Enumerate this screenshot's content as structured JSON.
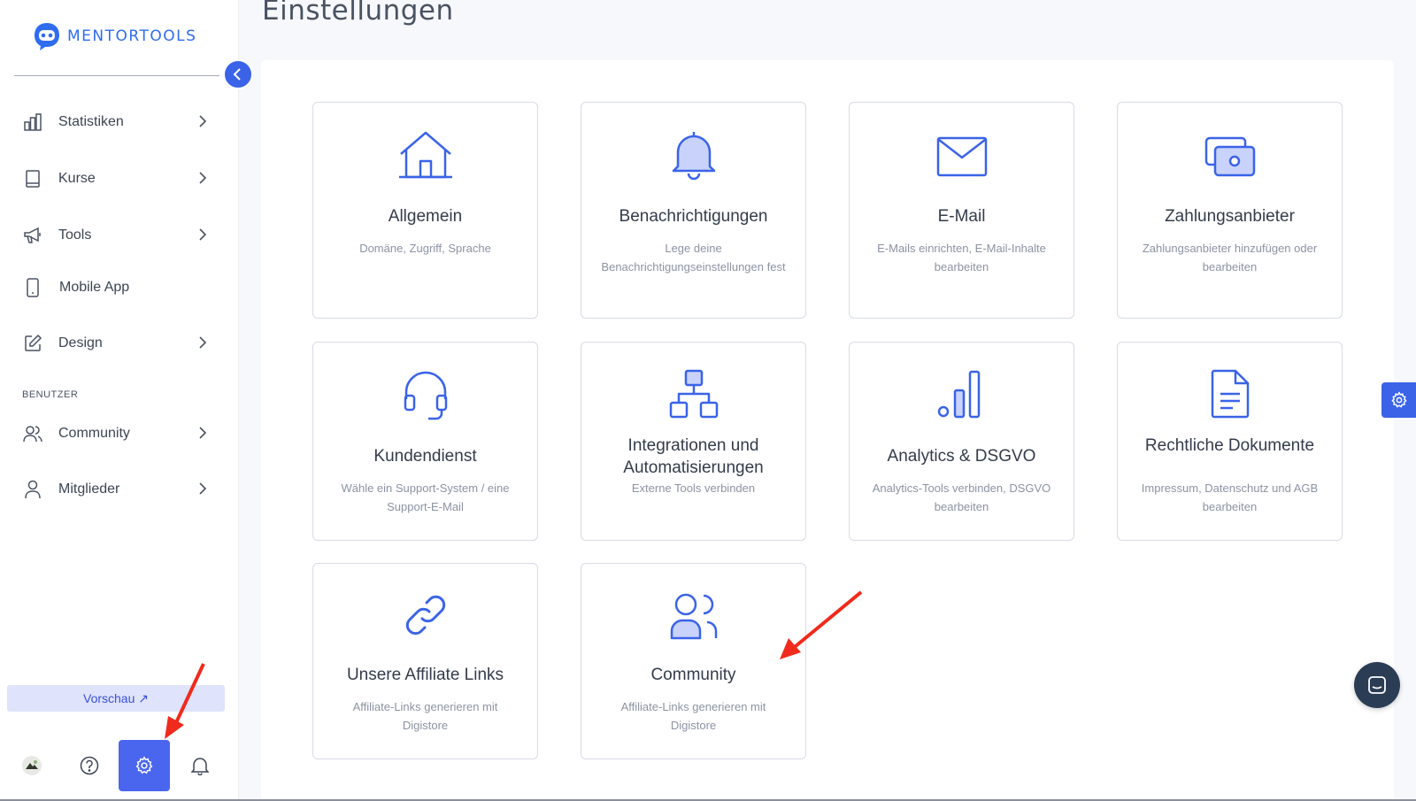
{
  "brand": {
    "name": "MENTORTOOLS",
    "color": "#2f6cf0"
  },
  "accent_color": "#3a63e8",
  "sidebar": {
    "items": [
      {
        "label": "Statistiken",
        "icon": "bar-chart-icon",
        "has_chevron": true
      },
      {
        "label": "Kurse",
        "icon": "book-icon",
        "has_chevron": true
      },
      {
        "label": "Tools",
        "icon": "megaphone-icon",
        "has_chevron": true
      },
      {
        "label": "Mobile App",
        "icon": "phone-icon",
        "has_chevron": false
      },
      {
        "label": "Design",
        "icon": "edit-icon",
        "has_chevron": true
      }
    ],
    "section_label": "BENUTZER",
    "user_items": [
      {
        "label": "Community",
        "icon": "users-icon",
        "has_chevron": true
      },
      {
        "label": "Mitglieder",
        "icon": "user-icon",
        "has_chevron": true
      }
    ],
    "preview_label": "Vorschau ↗",
    "bottom": [
      "avatar",
      "help-icon",
      "gear-icon",
      "bell-icon"
    ]
  },
  "page": {
    "title": "Einstellungen"
  },
  "cards": [
    {
      "title": "Allgemein",
      "desc": "Domäne, Zugriff, Sprache",
      "icon": "home-icon"
    },
    {
      "title": "Benachrichtigungen",
      "desc": "Lege deine Benachrichtigungseinstellungen fest",
      "icon": "bell-icon"
    },
    {
      "title": "E-Mail",
      "desc": "E-Mails einrichten, E-Mail-Inhalte bearbeiten",
      "icon": "mail-icon"
    },
    {
      "title": "Zahlungsanbieter",
      "desc": "Zahlungsanbieter hinzufügen oder bearbeiten",
      "icon": "money-icon"
    },
    {
      "title": "Kundendienst",
      "desc": "Wähle ein Support-System / eine Support-E-Mail",
      "icon": "headset-icon"
    },
    {
      "title": "Integrationen und Automatisierungen",
      "desc": "Externe Tools verbinden",
      "icon": "hierarchy-icon"
    },
    {
      "title": "Analytics & DSGVO",
      "desc": "Analytics-Tools verbinden, DSGVO bearbeiten",
      "icon": "analytics-icon"
    },
    {
      "title": "Rechtliche Dokumente",
      "desc": "Impressum, Datenschutz und AGB bearbeiten",
      "icon": "document-icon"
    },
    {
      "title": "Unsere Affiliate Links",
      "desc": "Affiliate-Links generieren mit Digistore",
      "icon": "link-icon"
    },
    {
      "title": "Community",
      "desc": "Affiliate-Links generieren mit Digistore",
      "icon": "users-icon"
    }
  ]
}
